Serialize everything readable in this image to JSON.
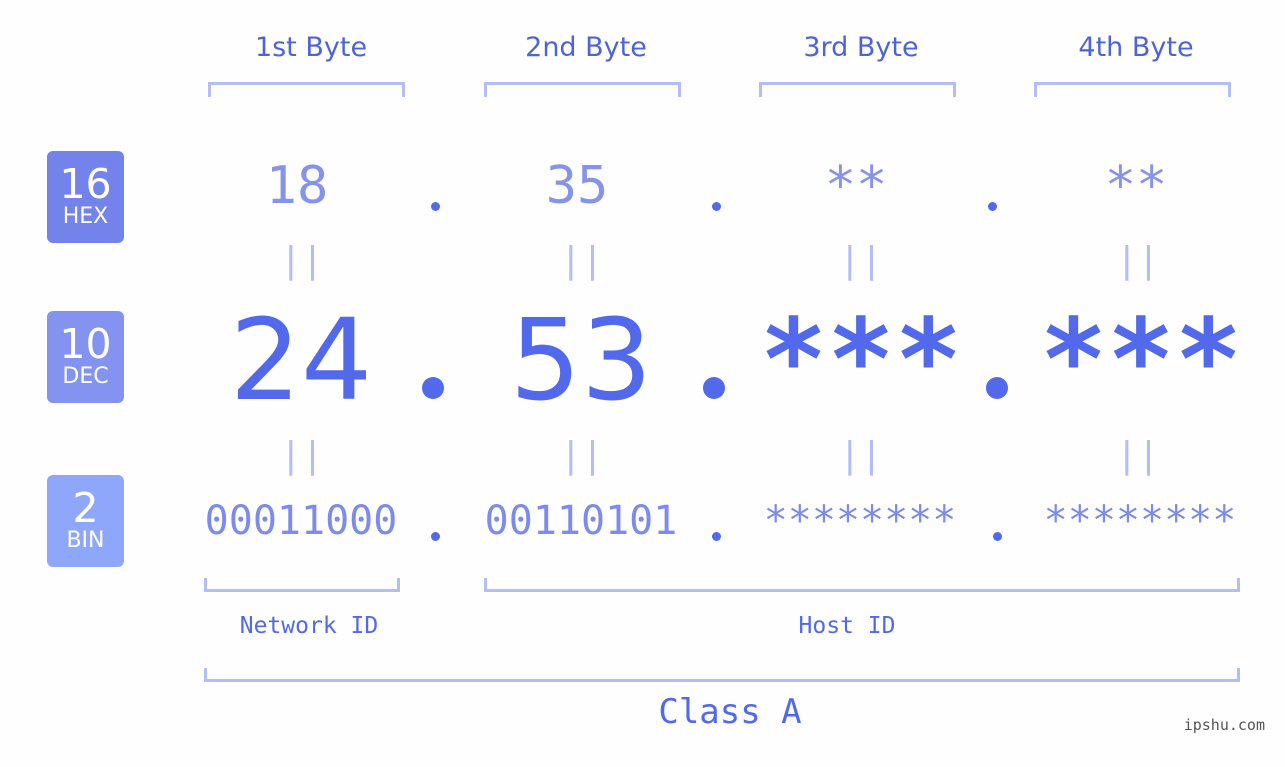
{
  "bytes": {
    "labels": [
      "1st Byte",
      "2nd Byte",
      "3rd Byte",
      "4th Byte"
    ]
  },
  "badges": {
    "hex": {
      "num": "16",
      "label": "HEX",
      "color": "#7482ec"
    },
    "dec": {
      "num": "10",
      "label": "DEC",
      "color": "#8593f0"
    },
    "bin": {
      "num": "2",
      "label": "BIN",
      "color": "#8fa7fa"
    }
  },
  "values": {
    "hex": [
      "18",
      "35",
      "**",
      "**"
    ],
    "dec": [
      "24",
      "53",
      "***",
      "***"
    ],
    "bin": [
      "00011000",
      "00110101",
      "********",
      "********"
    ]
  },
  "separator": ".",
  "equals": "||",
  "sections": {
    "network_id": "Network ID",
    "host_id": "Host ID",
    "class": "Class A"
  },
  "watermark": "ipshu.com",
  "colors": {
    "accent": "#5169ea",
    "bracket": "#b3bdf7",
    "background": "#fdfefd"
  }
}
